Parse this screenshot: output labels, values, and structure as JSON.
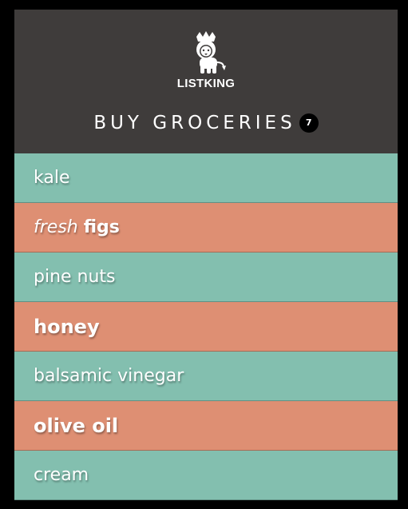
{
  "app": {
    "brand": "LISTKING",
    "logo_icon": "lion-king-icon"
  },
  "list": {
    "title": "BUY GROCERIES",
    "count": "7"
  },
  "items": [
    {
      "label": "kale",
      "weight": "light",
      "color": "#83bfaf"
    },
    {
      "label_italic": "fresh",
      "label_bold": "figs",
      "weight": "mixed",
      "color": "#de8f73"
    },
    {
      "label": "pine nuts",
      "weight": "light",
      "color": "#83bfaf"
    },
    {
      "label": "honey",
      "weight": "heavy",
      "color": "#de8f73"
    },
    {
      "label": "balsamic vinegar",
      "weight": "light",
      "color": "#83bfaf"
    },
    {
      "label": "olive oil",
      "weight": "heavy",
      "color": "#de8f73"
    },
    {
      "label": "cream",
      "weight": "light",
      "color": "#83bfaf"
    }
  ],
  "colors": {
    "header_bg": "#3f3c3b",
    "teal": "#83bfaf",
    "salmon": "#de8f73"
  }
}
